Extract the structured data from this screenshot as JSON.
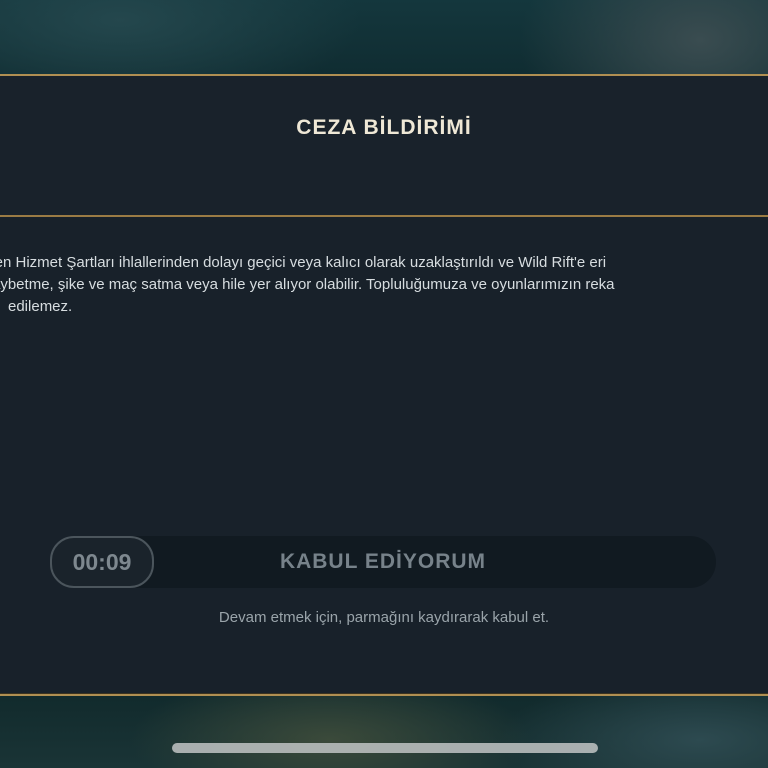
{
  "modal": {
    "title": "CEZA BİLDİRİMİ",
    "body_lines": [
      "ilen Hizmet Şartları ihlallerinden dolayı geçici veya kalıcı olarak uzaklaştırıldı ve Wild Rift'e eri",
      "aybetme, şike ve maç satma veya hile yer alıyor olabilir. Topluluğumuza ve oyunlarımızın reka",
      "edilemez."
    ],
    "timer": "00:09",
    "accept_label": "KABUL EDİYORUM",
    "hint": "Devam etmek için, parmağını kaydırarak kabul et."
  },
  "colors": {
    "gold_border": "#b08f52",
    "panel": "#18212a",
    "title": "#efe8d6"
  }
}
